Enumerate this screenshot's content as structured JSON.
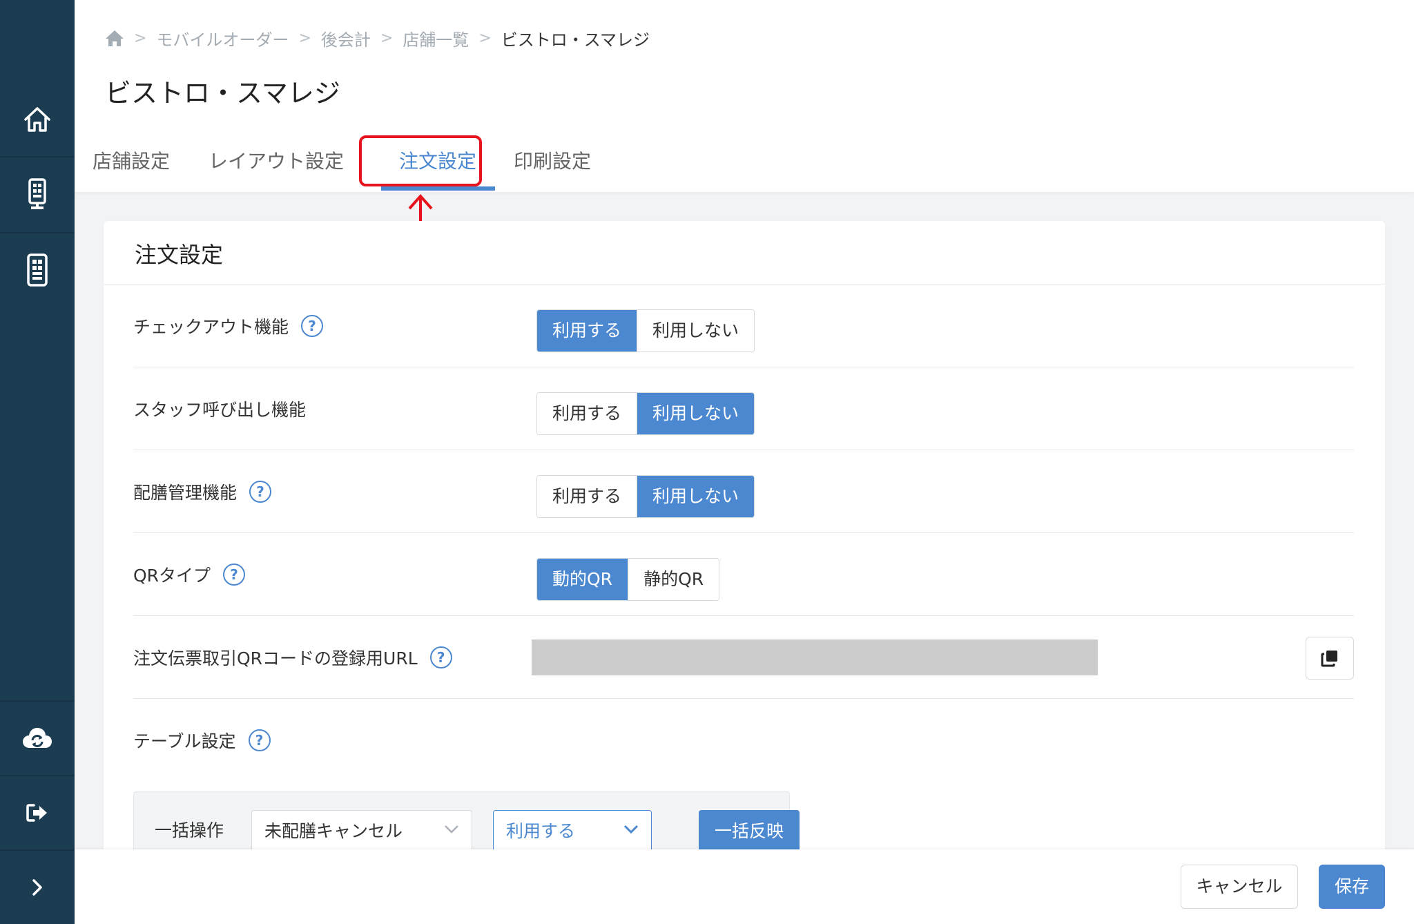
{
  "colors": {
    "sidebar": "#1c3c52",
    "accent": "#4b88d0",
    "highlight": "#e8141d"
  },
  "sidebar": {
    "items": [
      {
        "icon": "home-icon"
      },
      {
        "icon": "kiosk-icon"
      },
      {
        "icon": "tablet-icon"
      },
      {
        "icon": "cloud-sync-icon"
      },
      {
        "icon": "logout-icon"
      },
      {
        "icon": "chevron-right-icon"
      }
    ]
  },
  "breadcrumb": {
    "home_icon": "home-icon",
    "items": [
      "モバイルオーダー",
      "後会計",
      "店舗一覧"
    ],
    "current": "ビストロ・スマレジ"
  },
  "page_title": "ビストロ・スマレジ",
  "tabs": [
    {
      "label": "店舗設定"
    },
    {
      "label": "レイアウト設定"
    },
    {
      "label": "注文設定",
      "active": true
    },
    {
      "label": "印刷設定"
    }
  ],
  "card": {
    "title": "注文設定",
    "rows": [
      {
        "label": "チェックアウト機能",
        "help": "?",
        "options": [
          "利用する",
          "利用しない"
        ],
        "selected": "利用する"
      },
      {
        "label": "スタッフ呼び出し機能",
        "options": [
          "利用する",
          "利用しない"
        ],
        "selected": "利用しない"
      },
      {
        "label": "配膳管理機能",
        "help": "?",
        "options": [
          "利用する",
          "利用しない"
        ],
        "selected": "利用しない"
      },
      {
        "label": "QRタイプ",
        "help": "?",
        "options": [
          "動的QR",
          "静的QR"
        ],
        "selected": "動的QR"
      },
      {
        "label": "注文伝票取引QRコードの登録用URL",
        "help": "?"
      },
      {
        "label": "テーブル設定",
        "help": "?"
      }
    ],
    "bulk": {
      "label": "一括操作",
      "action_select": "未配膳キャンセル",
      "value_select": "利用する",
      "apply": "一括反映"
    }
  },
  "footer": {
    "cancel": "キャンセル",
    "save": "保存"
  }
}
